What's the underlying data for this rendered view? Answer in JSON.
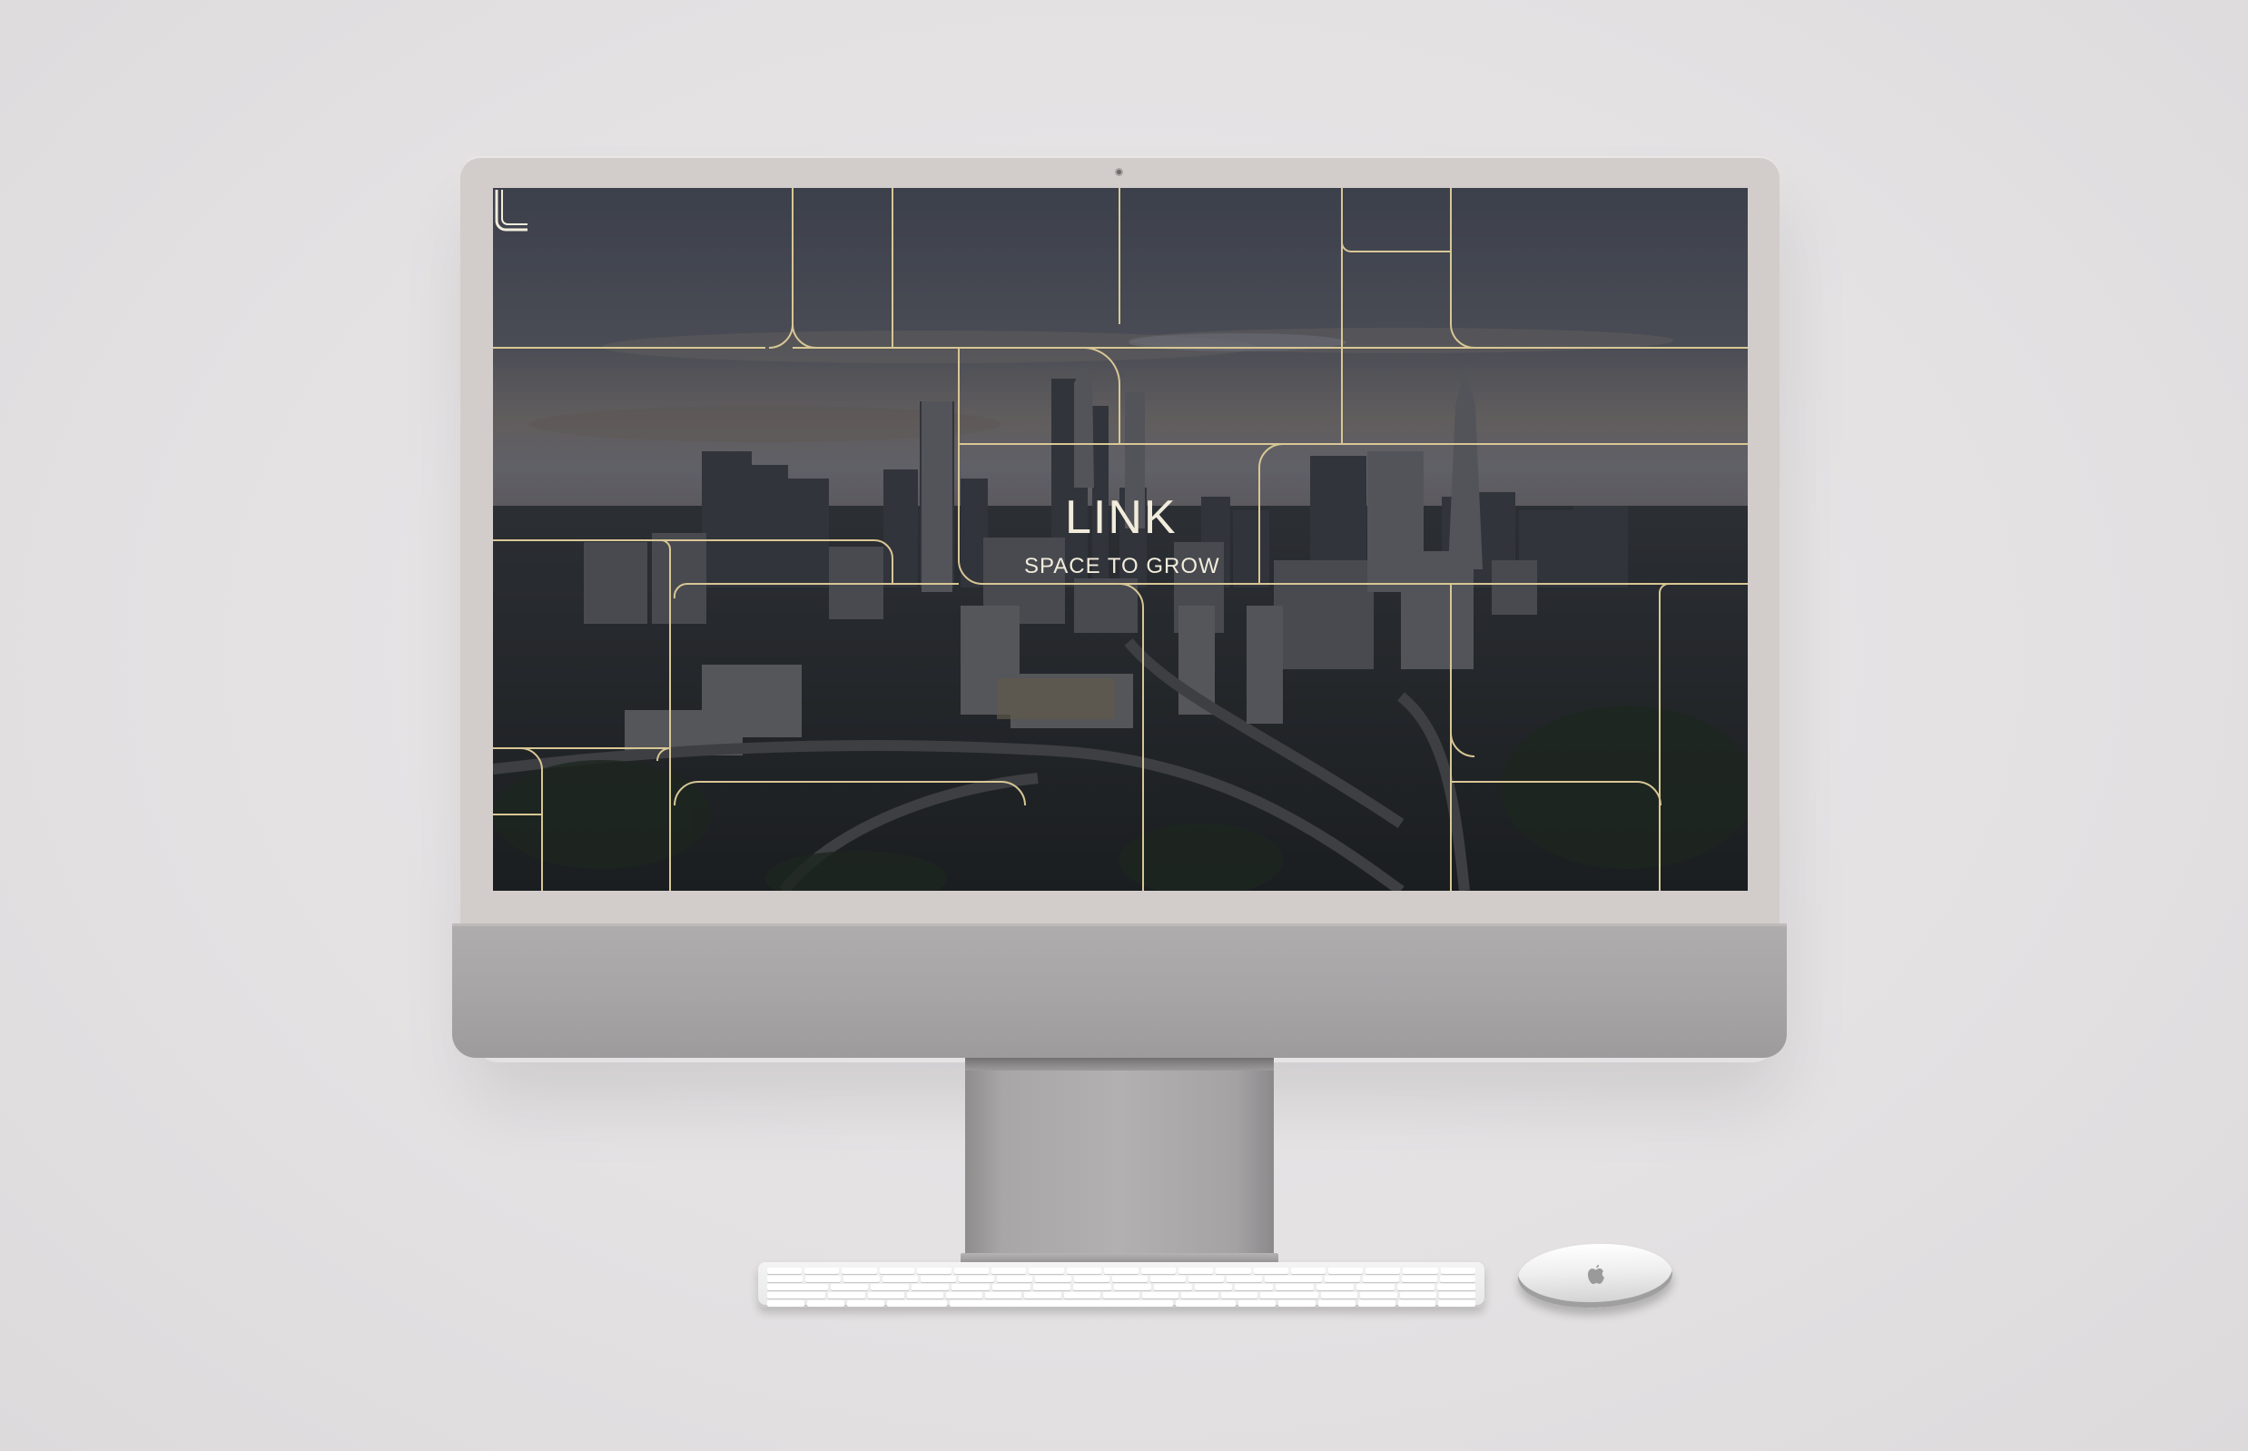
{
  "screen": {
    "logo_text": "LINK",
    "tagline": "SPACE TO GROW"
  },
  "colors": {
    "background": "#e5e3e4",
    "bezel": "#d2cdcb",
    "chin": "#a7a5a6",
    "grid_lines": "#d8c795",
    "logo_text": "#f2ecdc",
    "sky": "#4a4f5e"
  },
  "icons": {
    "logo_mark": "link-l-mark-icon",
    "camera": "camera-icon",
    "mouse_logo": "apple-logo-icon"
  }
}
